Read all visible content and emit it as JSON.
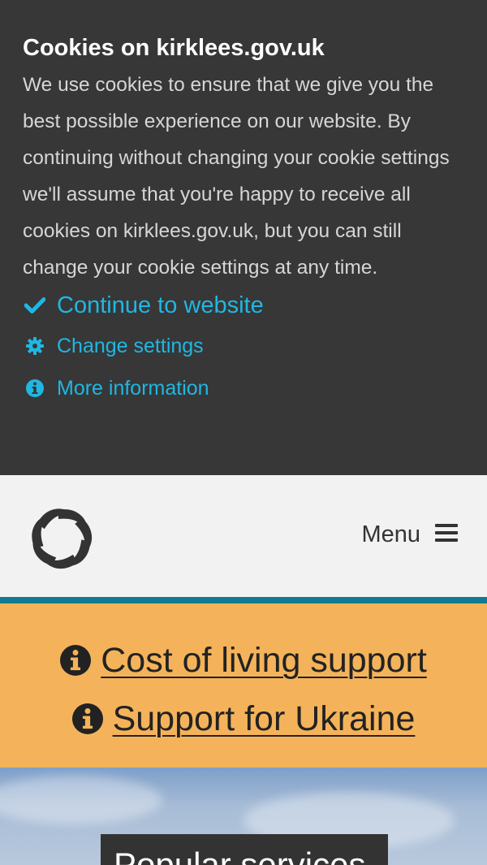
{
  "cookie_banner": {
    "title": "Cookies on kirklees.gov.uk",
    "body": "We use cookies to ensure that we give you the best possible experience on our website. By continuing without changing your cookie settings we'll assume that you're happy to receive all cookies on kirklees.gov.uk, but you can still change your cookie settings at any time.",
    "continue_label": "Continue to website",
    "change_settings_label": "Change settings",
    "more_info_label": "More information",
    "link_color": "#1fb7e3",
    "background_color": "#373737"
  },
  "header": {
    "menu_label": "Menu",
    "logo_icon": "kirklees-logo-icon",
    "menu_icon": "hamburger-icon"
  },
  "alerts": {
    "items": [
      {
        "label": "Cost of living support",
        "icon": "info-circle-icon"
      },
      {
        "label": "Support for Ukraine",
        "icon": "info-circle-icon"
      }
    ],
    "background_color": "#f4b35a",
    "accent_line_color": "#127a90"
  },
  "hero": {
    "popular_services_label": "Popular services"
  }
}
